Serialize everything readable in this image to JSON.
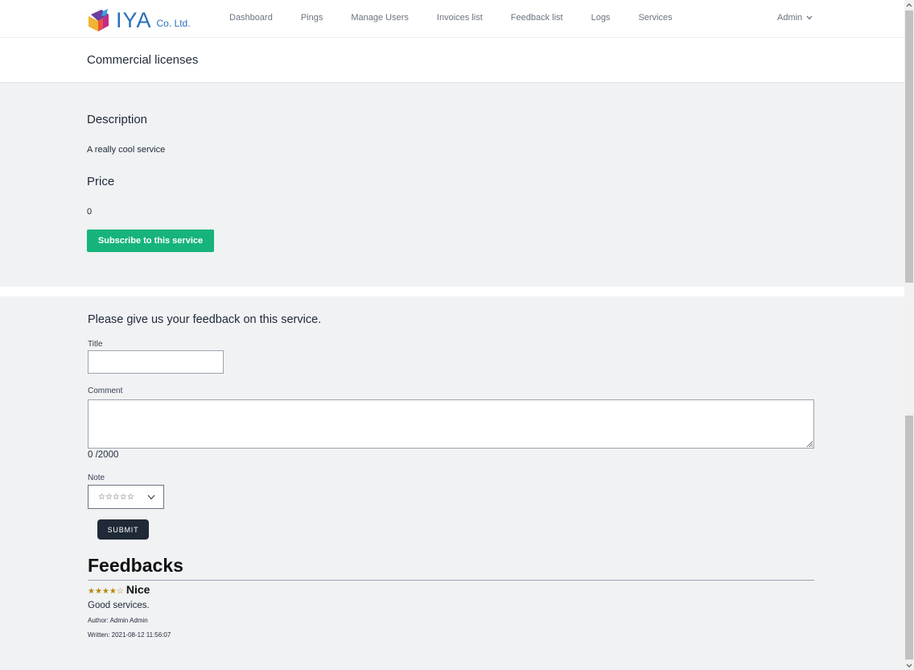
{
  "brand": {
    "name": "IYA",
    "suffix": "Co. Ltd."
  },
  "nav": {
    "items": [
      "Dashboard",
      "Pings",
      "Manage Users",
      "Invoices list",
      "Feedback list",
      "Logs",
      "Services"
    ],
    "user_menu": "Admin"
  },
  "page": {
    "title": "Commercial licenses"
  },
  "service": {
    "description_heading": "Description",
    "description": "A really cool service",
    "price_heading": "Price",
    "price": "0",
    "subscribe_label": "Subscribe to this service"
  },
  "feedback_form": {
    "heading": "Please give us your feedback on this service.",
    "title_label": "Title",
    "title_value": "",
    "comment_label": "Comment",
    "comment_value": "",
    "counter": "0 /2000",
    "note_label": "Note",
    "note_value": "☆☆☆☆☆",
    "submit_label": "SUBMIT"
  },
  "feedbacks": {
    "heading": "Feedbacks",
    "items": [
      {
        "stars": "★★★★☆",
        "title": "Nice",
        "body": "Good services.",
        "author": "Author: Admin Admin",
        "written": "Written: 2021-08-12 11:56:07"
      }
    ]
  },
  "colors": {
    "brand_blue": "#2b6fb8",
    "subscribe_green": "#16b47a",
    "submit_dark": "#1f2937",
    "star_gold": "#b8860b"
  },
  "icons": {
    "logo": "book-logo-icon",
    "user_menu": "chevron-down-icon",
    "note_select": "chevron-down-icon"
  }
}
